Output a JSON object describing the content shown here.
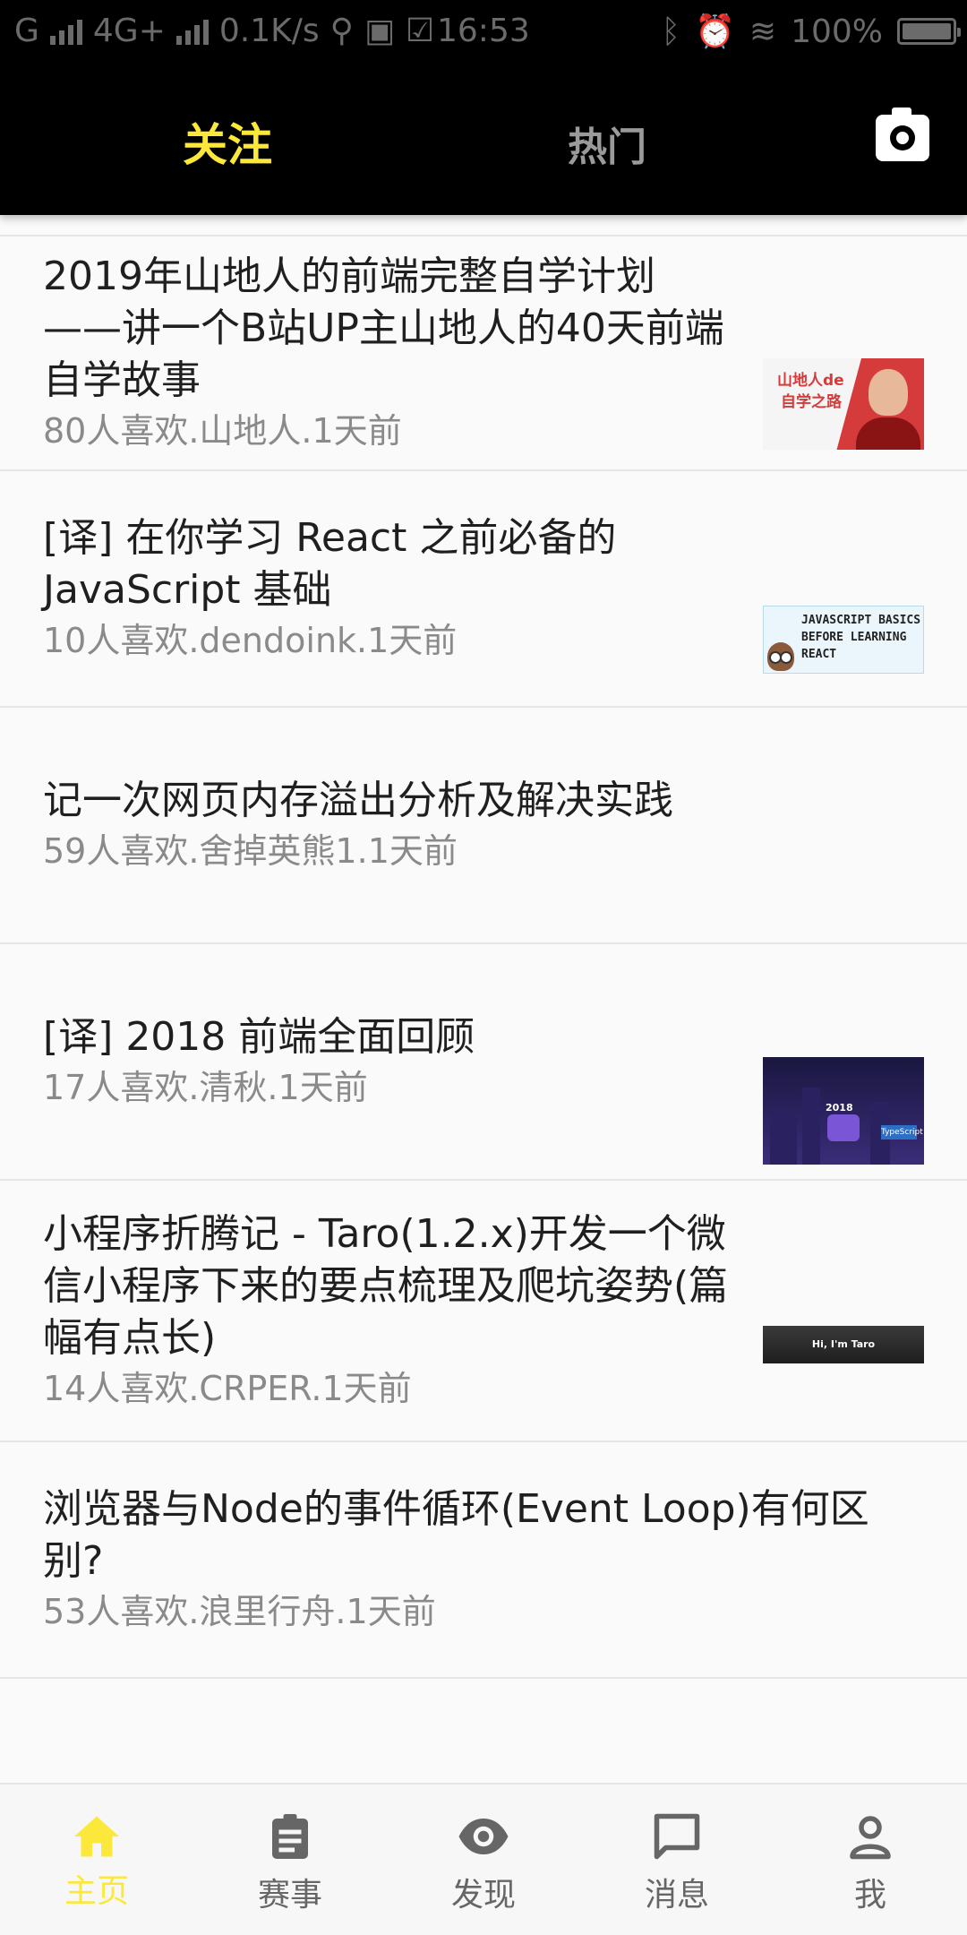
{
  "status_bar": {
    "network_left": "G",
    "network_mid": "4G+",
    "speed": "0.1K/s",
    "time": "16:53",
    "battery": "100%"
  },
  "header": {
    "tabs": [
      {
        "label": "关注",
        "active": true
      },
      {
        "label": "热门",
        "active": false
      }
    ],
    "camera_icon": "camera-icon"
  },
  "feed": {
    "items": [
      {
        "title": "2019年山地人的前端完整自学计划——讲一个B站UP主山地人的40天前端自学故事",
        "meta": "80人喜欢.山地人.1天前",
        "thumb_text": [
          "山地人de",
          "自学之路"
        ]
      },
      {
        "title": "[译] 在你学习 React 之前必备的 JavaScript 基础",
        "meta": "10人喜欢.dendoink.1天前",
        "thumb_text": [
          "JAVASCRIPT BASICS",
          "BEFORE LEARNING",
          "REACT"
        ]
      },
      {
        "title": "记一次网页内存溢出分析及解决实践",
        "meta": "59人喜欢.舍掉英熊1.1天前"
      },
      {
        "title": "[译] 2018 前端全面回顾",
        "meta": "17人喜欢.清秋.1天前",
        "thumb_text": [
          "2018",
          "TypeScript"
        ]
      },
      {
        "title": "小程序折腾记 - Taro(1.2.x)开发一个微信小程序下来的要点梳理及爬坑姿势(篇幅有点长)",
        "meta": "14人喜欢.CRPER.1天前",
        "thumb_text": [
          "Hi, I'm Taro"
        ]
      },
      {
        "title": "浏览器与Node的事件循环(Event Loop)有何区别?",
        "meta": "53人喜欢.浪里行舟.1天前"
      }
    ]
  },
  "tab_bar": {
    "items": [
      {
        "label": "主页",
        "icon": "home-icon",
        "active": true
      },
      {
        "label": "赛事",
        "icon": "clipboard-icon",
        "active": false
      },
      {
        "label": "发现",
        "icon": "eye-icon",
        "active": false
      },
      {
        "label": "消息",
        "icon": "message-icon",
        "active": false
      },
      {
        "label": "我",
        "icon": "person-icon",
        "active": false
      }
    ]
  },
  "colors": {
    "accent": "#fce83a",
    "header_bg": "#000000",
    "text_primary": "#1f1f1f",
    "text_secondary": "#8a8a8a"
  }
}
